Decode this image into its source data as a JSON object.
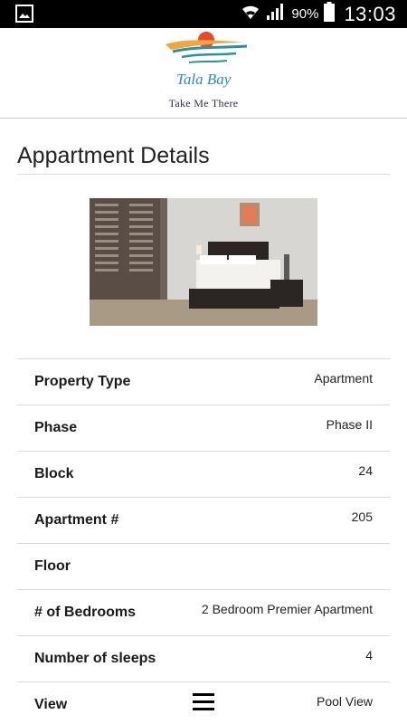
{
  "status_bar": {
    "battery_percent": "90%",
    "time": "13:03",
    "icons": [
      "gallery-notification-icon",
      "wifi-icon",
      "signal-icon",
      "battery-icon"
    ]
  },
  "header": {
    "logo_text": "Tala Bay",
    "tagline": "Take Me There"
  },
  "page": {
    "title": "Appartment Details"
  },
  "details": [
    {
      "label": "Property Type",
      "value": "Apartment"
    },
    {
      "label": "Phase",
      "value": "Phase II"
    },
    {
      "label": "Block",
      "value": "24"
    },
    {
      "label": "Apartment #",
      "value": "205"
    },
    {
      "label": "Floor",
      "value": ""
    },
    {
      "label": "# of Bedrooms",
      "value": "2 Bedroom Premier Apartment"
    },
    {
      "label": "Number of sleeps",
      "value": "4"
    },
    {
      "label": "View",
      "value": "Pool View"
    }
  ],
  "colors": {
    "status_bar_bg": "#000000",
    "logo_teal": "#2a8fa8",
    "logo_sun": "#e8482a",
    "logo_sand": "#f0a63a"
  }
}
